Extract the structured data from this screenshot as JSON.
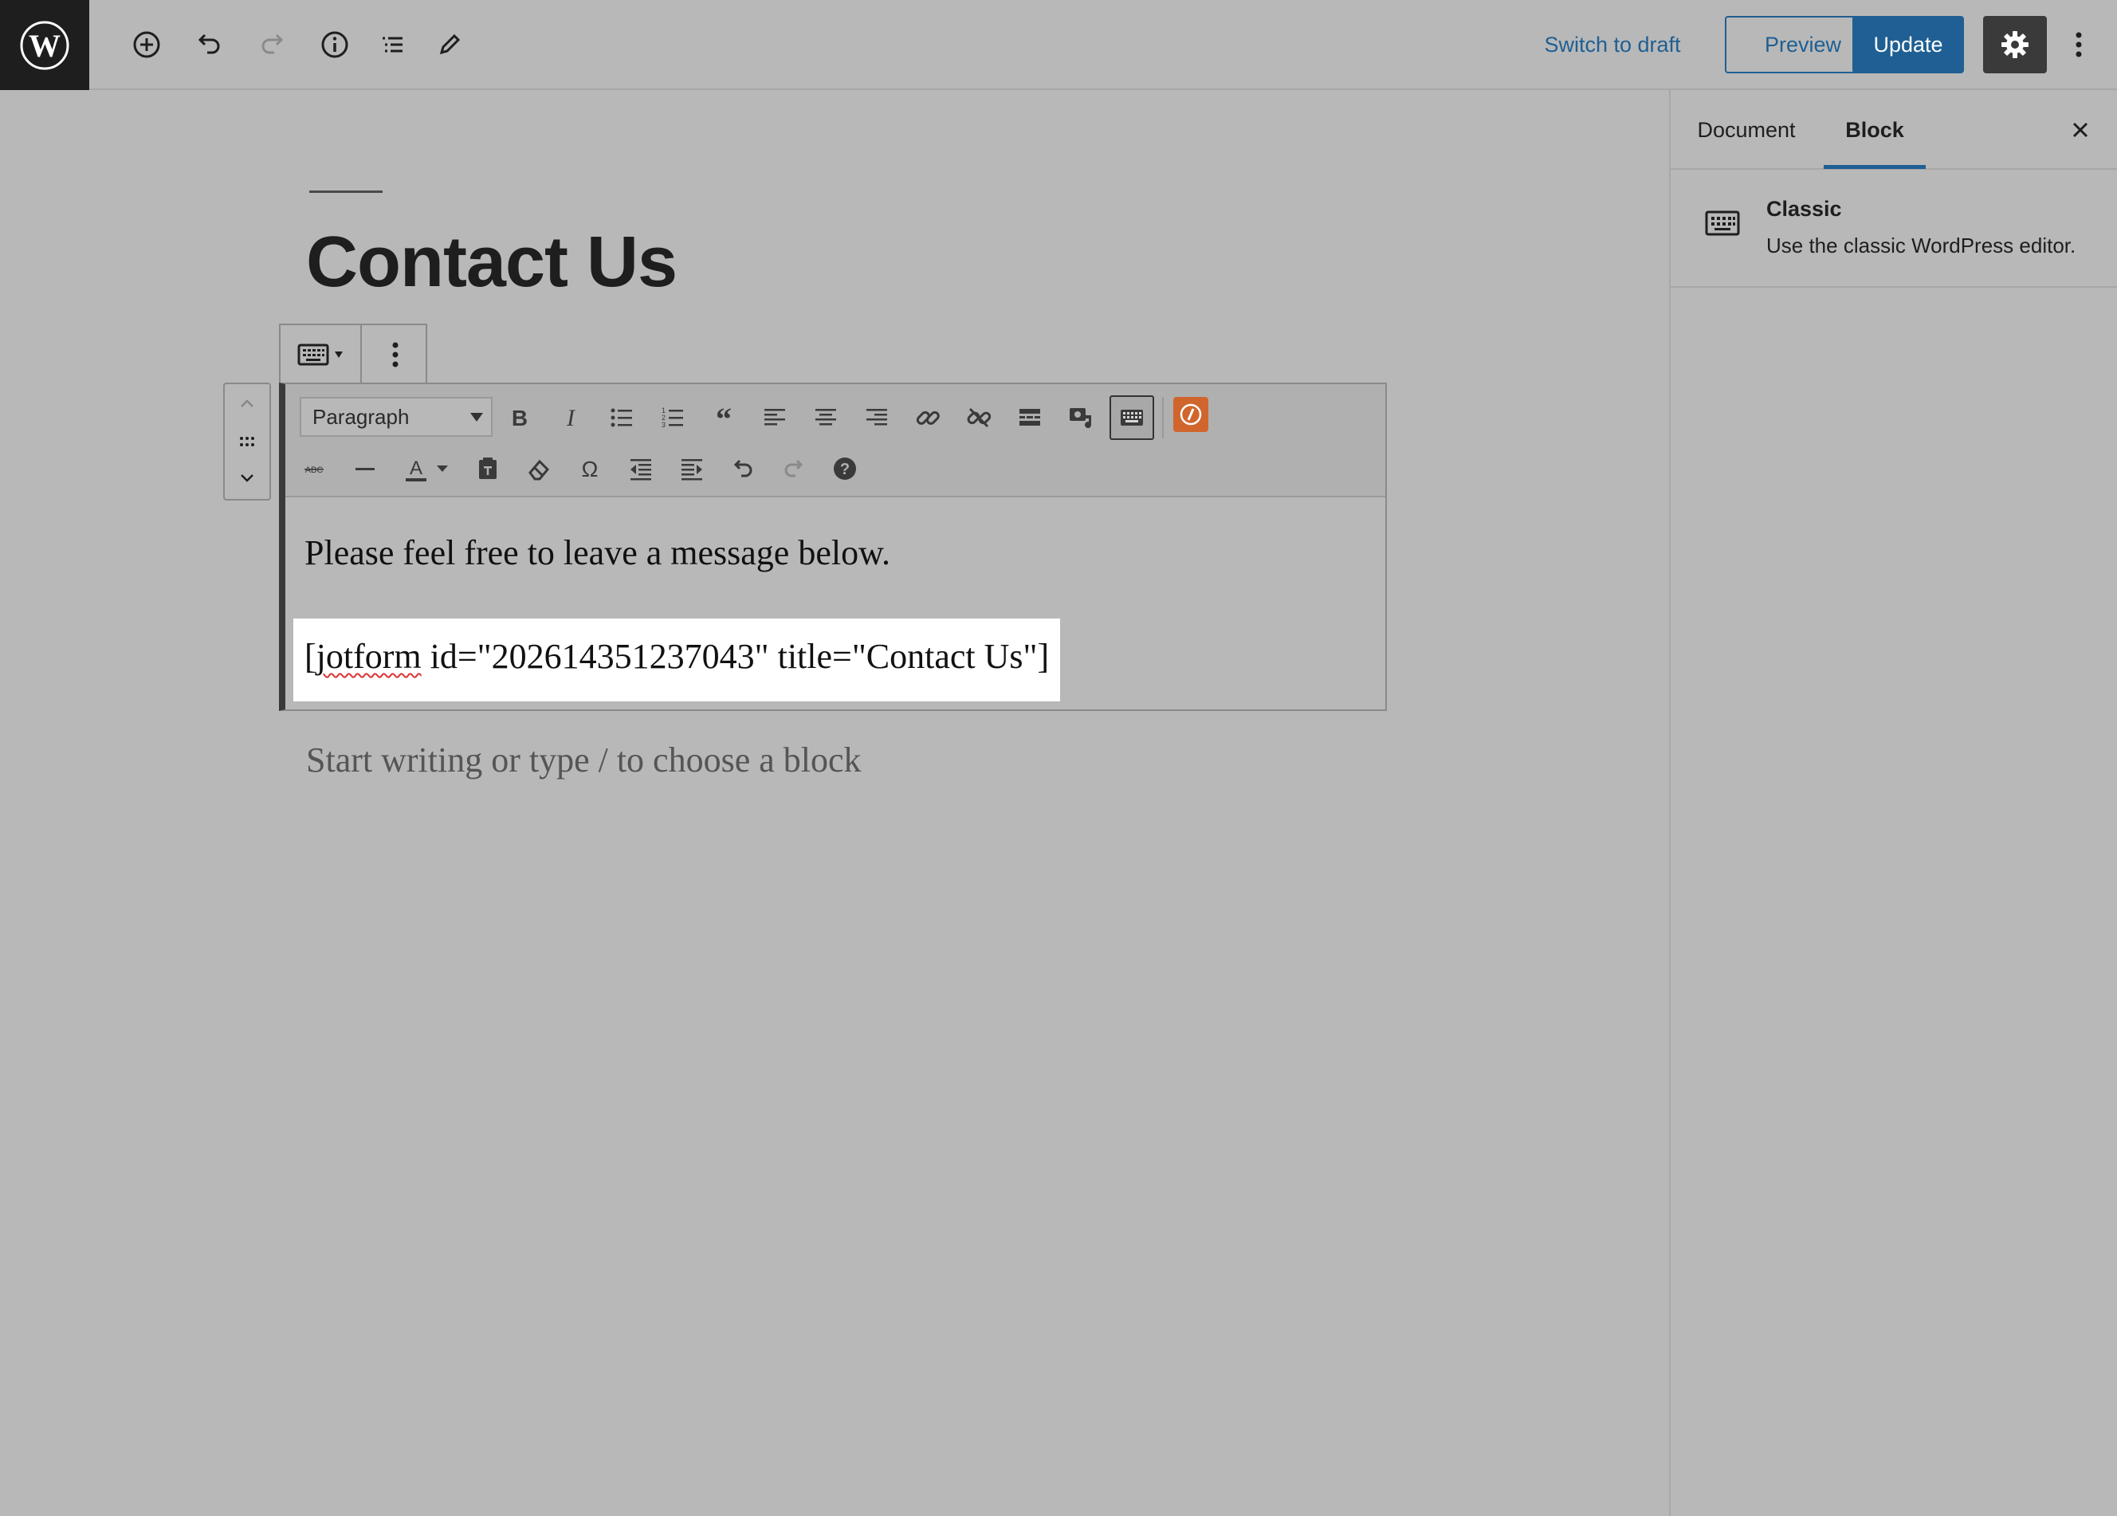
{
  "topbar": {
    "switch_draft": "Switch to draft",
    "preview": "Preview",
    "update": "Update",
    "icons": [
      "wordpress-logo",
      "add-block",
      "undo",
      "redo",
      "info",
      "list-view",
      "tools-edit",
      "settings-gear",
      "more-vertical"
    ]
  },
  "sidebar": {
    "tabs": [
      {
        "label": "Document"
      },
      {
        "label": "Block"
      }
    ],
    "active_tab": "Block",
    "block_card": {
      "title": "Classic",
      "description": "Use the classic WordPress editor."
    }
  },
  "editor": {
    "post_title": "Contact Us",
    "format_select": "Paragraph",
    "paragraph": "Please feel free to leave a message below.",
    "shortcode": {
      "open": "[",
      "squiggled": "jotform",
      "rest": " id=\"202614351237043\" title=\"Contact Us\"]"
    },
    "placeholder": "Start writing or type / to choose a block"
  },
  "colors": {
    "background": "#b8b8b8",
    "accent": "#1f5f93",
    "dark": "#1e1e1e",
    "jotform": "#d0662d"
  }
}
